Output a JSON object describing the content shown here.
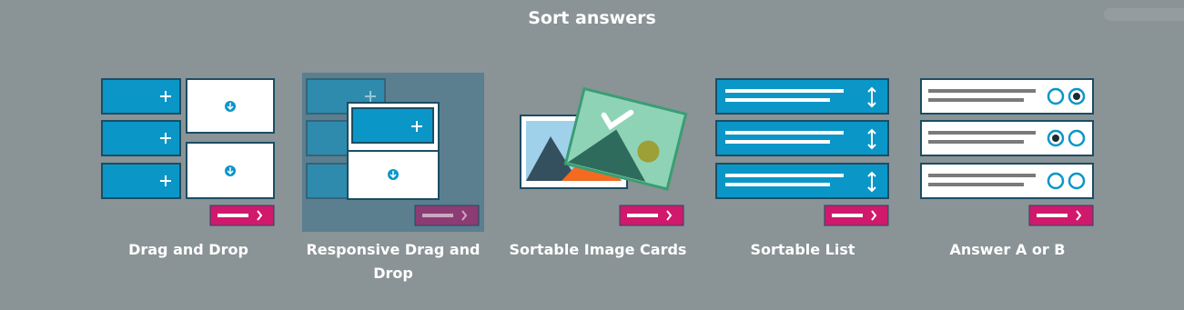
{
  "header": {
    "title": "Sort answers"
  },
  "cards": [
    {
      "label": "Drag and Drop"
    },
    {
      "label": "Responsive Drag and Drop"
    },
    {
      "label": "Sortable Image Cards"
    },
    {
      "label": "Sortable List"
    },
    {
      "label": "Answer A or B"
    }
  ],
  "colors": {
    "background": "#8a9396",
    "blue": "#0b96c8",
    "border": "#1b4d63",
    "pink": "#d0196c",
    "selected": "#5b7f8f"
  },
  "icons": [
    "move-icon",
    "download-icon",
    "arrow-right-icon",
    "checkmark-icon",
    "vertical-arrows-icon",
    "radio-icon"
  ]
}
